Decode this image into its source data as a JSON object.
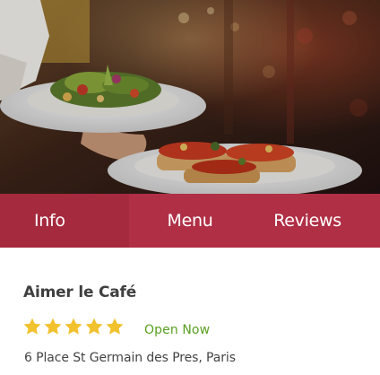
{
  "hero": {
    "image": "restaurant-plates-photo"
  },
  "tabs": [
    {
      "label": "Info",
      "selected": true
    },
    {
      "label": "Menu",
      "selected": false
    },
    {
      "label": "Reviews",
      "selected": false
    }
  ],
  "restaurant": {
    "name": "Aimer le Café",
    "rating": 5,
    "rating_max": 5,
    "status": "Open Now",
    "address": "6 Place St Germain des Pres, Paris"
  },
  "colors": {
    "tab_bar": "#b02f45",
    "tab_selected": "#a52a3e",
    "star": "#f2c12e",
    "open_status": "#5aa020"
  }
}
